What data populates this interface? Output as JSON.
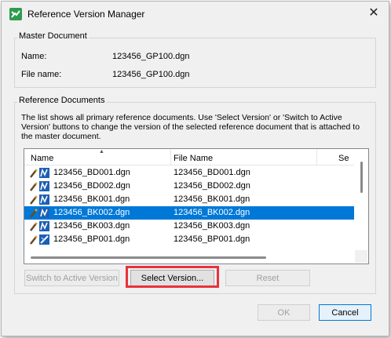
{
  "window": {
    "title": "Reference Version Manager",
    "close_glyph": "✕"
  },
  "master": {
    "group_label": "Master Document",
    "name_label": "Name:",
    "name_value": "123456_GP100.dgn",
    "file_label": "File name:",
    "file_value": "123456_GP100.dgn"
  },
  "references": {
    "group_label": "Reference Documents",
    "description": "The list shows all primary reference documents. Use 'Select Version' or 'Switch to Active Version' buttons to change the version of the selected reference document that is attached to the master document.",
    "columns": [
      "Name",
      "File Name",
      "Se"
    ],
    "rows": [
      {
        "name": "123456_BD001.dgn",
        "file": "123456_BD001.dgn"
      },
      {
        "name": "123456_BD002.dgn",
        "file": "123456_BD002.dgn"
      },
      {
        "name": "123456_BK001.dgn",
        "file": "123456_BK001.dgn"
      },
      {
        "name": "123456_BK002.dgn",
        "file": "123456_BK002.dgn"
      },
      {
        "name": "123456_BK003.dgn",
        "file": "123456_BK003.dgn"
      },
      {
        "name": "123456_BP001.dgn",
        "file": "123456_BP001.dgn"
      }
    ],
    "selected_index": 3
  },
  "buttons": {
    "switch_active": "Switch to Active Version",
    "select_version": "Select Version...",
    "reset": "Reset",
    "ok": "OK",
    "cancel": "Cancel"
  },
  "colors": {
    "selection": "#0078d7",
    "highlight_box": "#e8323c",
    "app_icon": "#2e9c4e"
  }
}
